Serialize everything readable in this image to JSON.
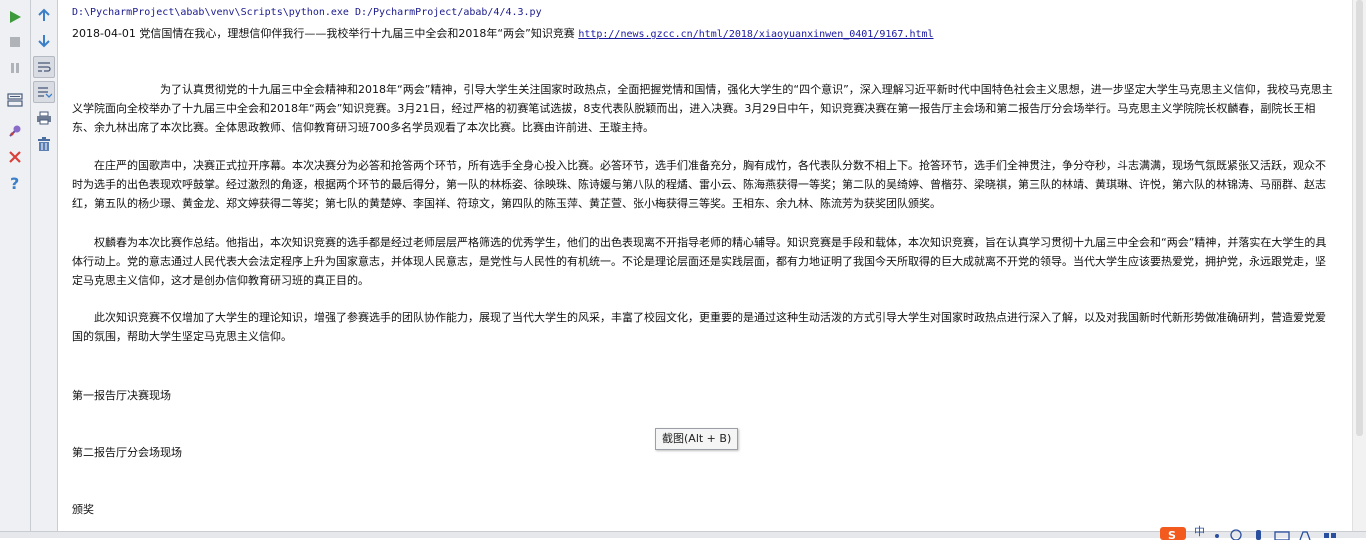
{
  "toolbar": {
    "left": [
      {
        "name": "run-icon"
      },
      {
        "name": "stop-icon"
      },
      {
        "name": "pause-icon"
      },
      {
        "name": "restore-layout-icon"
      },
      {
        "name": "pin-icon"
      },
      {
        "name": "close-icon"
      },
      {
        "name": "help-icon"
      }
    ],
    "right": [
      {
        "name": "arrow-up-icon"
      },
      {
        "name": "arrow-down-icon"
      },
      {
        "name": "soft-wrap-icon"
      },
      {
        "name": "scroll-to-end-icon"
      },
      {
        "name": "print-icon"
      },
      {
        "name": "trash-icon"
      }
    ]
  },
  "console": {
    "command": "D:\\PycharmProject\\abab\\venv\\Scripts\\python.exe D:/PycharmProject/abab/4/4.3.py",
    "header_date_title": "2018-04-01 党信国情在我心，理想信仰伴我行——我校举行十九届三中全会和2018年“两会”知识竞赛",
    "header_url": "http://news.gzcc.cn/html/2018/xiaoyuanxinwen_0401/9167.html",
    "paragraphs": [
      "　　　　　　　　为了认真贯彻党的十九届三中全会精神和2018年“两会”精神，引导大学生关注国家时政热点，全面把握党情和国情，强化大学生的“四个意识”，深入理解习近平新时代中国特色社会主义思想，进一步坚定大学生马克思主义信仰，我校马克思主义学院面向全校举办了十九届三中全会和2018年“两会”知识竞赛。3月21日，经过严格的初赛笔试选拔，8支代表队脱颖而出，进入决赛。3月29日中午，知识竞赛决赛在第一报告厅主会场和第二报告厅分会场举行。马克思主义学院院长权麟春，副院长王相东、余九林出席了本次比赛。全体思政教师、信仰教育研习班700多名学员观看了本次比赛。比赛由许前进、王璇主持。",
      "　　在庄严的国歌声中，决赛正式拉开序幕。本次决赛分为必答和抢答两个环节，所有选手全身心投入比赛。必答环节，选手们准备充分，胸有成竹，各代表队分数不相上下。抢答环节，选手们全神贯注，争分夺秒，斗志满满，现场气氛既紧张又活跃，观众不时为选手的出色表现欢呼鼓掌。经过激烈的角逐，根据两个环节的最后得分，第一队的林栎姿、徐映珠、陈诗媛与第八队的程燏、雷小云、陈海燕获得一等奖；第二队的吴绮婷、曾楷芬、梁晓祺，第三队的林靖、黄琪琳、许悦，第六队的林锦涛、马丽群、赵志红，第五队的杨少璟、黄金龙、郑文婷获得二等奖；第七队的黄楚婷、李国祥、符琼文，第四队的陈玉萍、黄芷萱、张小梅获得三等奖。王相东、余九林、陈流芳为获奖团队颁奖。",
      "　　权麟春为本次比赛作总结。他指出，本次知识竞赛的选手都是经过老师层层严格筛选的优秀学生，他们的出色表现离不开指导老师的精心辅导。知识竞赛是手段和载体，本次知识竞赛，旨在认真学习贯彻十九届三中全会和“两会”精神，并落实在大学生的具体行动上。党的意志通过人民代表大会法定程序上升为国家意志，并体现人民意志，是党性与人民性的有机统一。不论是理论层面还是实践层面，都有力地证明了我国今天所取得的巨大成就离不开党的领导。当代大学生应该要热爱党，拥护党，永远跟党走，坚定马克思主义信仰，这才是创办信仰教育研习班的真正目的。",
      "　　此次知识竞赛不仅增加了大学生的理论知识，增强了参赛选手的团队协作能力，展现了当代大学生的风采，丰富了校园文化，更重要的是通过这种生动活泼的方式引导大学生对国家时政热点进行深入了解，以及对我国新时代新形势做准确研判，营造爱党爱国的氛围，帮助大学生坚定马克思主义信仰。"
    ],
    "captions": [
      "第一报告厅决赛现场",
      "第二报告厅分会场现场",
      "颁奖"
    ]
  },
  "tooltip": "截图(Alt + B)",
  "tray": {
    "ime_label": "中"
  }
}
